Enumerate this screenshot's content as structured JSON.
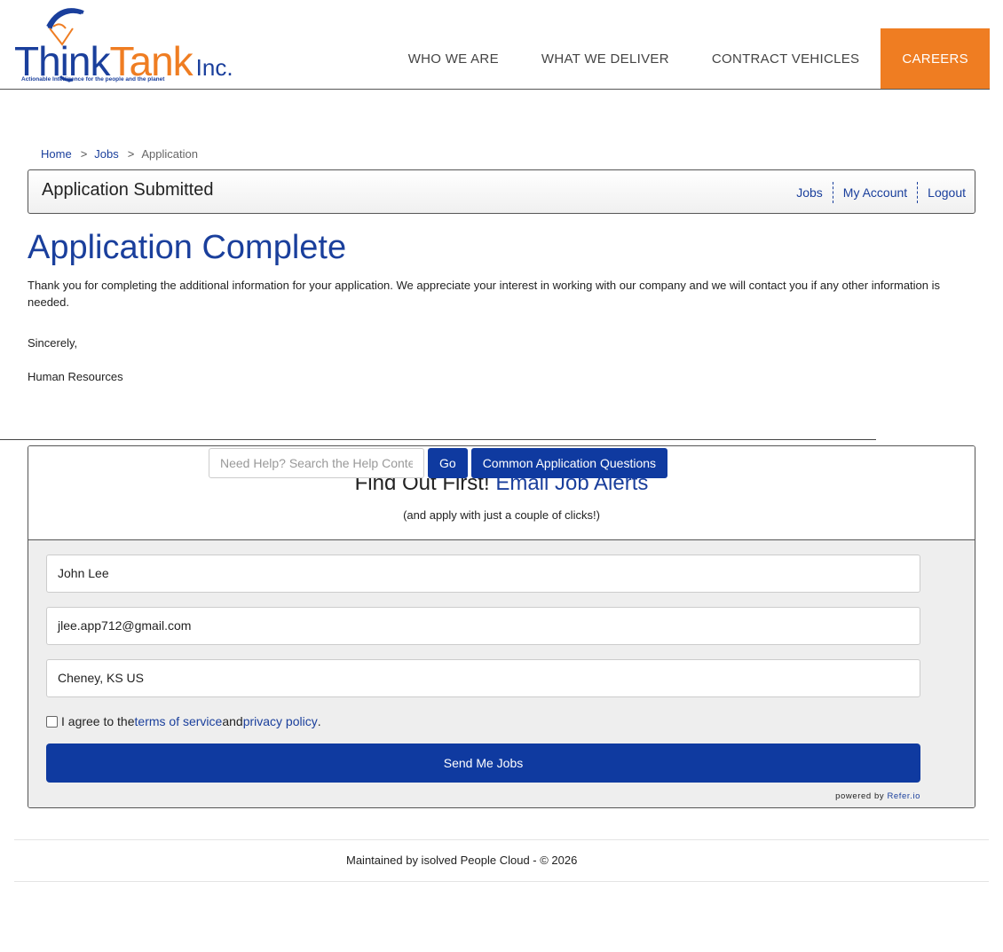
{
  "brand": {
    "name_part1": "Think",
    "name_part2": "Tank",
    "suffix": "Inc.",
    "tagline": "Actionable       Intelligence for the people and the planet",
    "colors": {
      "blue": "#1a3f9c",
      "orange": "#ef7d22"
    }
  },
  "nav": {
    "items": [
      {
        "label": "WHO WE ARE"
      },
      {
        "label": "WHAT WE DELIVER"
      },
      {
        "label": "CONTRACT VEHICLES"
      },
      {
        "label": "CAREERS",
        "active": true
      }
    ]
  },
  "breadcrumb": {
    "home": "Home",
    "jobs": "Jobs",
    "current": "Application",
    "separator": ">"
  },
  "status_bar": {
    "title": "Application Submitted",
    "links": [
      "Jobs",
      "My Account",
      "Logout"
    ]
  },
  "main": {
    "heading": "Application Complete",
    "message": "Thank you for completing the additional information for your application. We appreciate your interest in working with our company and we will contact you if any other information is needed.",
    "sincerely": "Sincerely,",
    "signoff": "Human Resources"
  },
  "help": {
    "placeholder": "Need Help? Search the Help Content",
    "go_label": "Go",
    "questions_label": "Common Application Questions"
  },
  "alerts": {
    "title_plain": "Find Out First! ",
    "title_highlight": "Email Job Alerts",
    "subtitle": "(and apply with just a couple of clicks!)",
    "name_value": "John Lee",
    "email_value": "jlee.app712@gmail.com",
    "location_value": "Cheney, KS US",
    "agree_prefix": "I agree to the ",
    "terms_label": "terms of service",
    "agree_and": " and ",
    "privacy_label": "privacy policy",
    "agree_suffix": ".",
    "agree_checked": false,
    "send_label": "Send Me Jobs",
    "powered_prefix": "powered by ",
    "powered_brand": "Refer.io"
  },
  "footer": {
    "text": "Maintained by isolved People Cloud - © 2026"
  },
  "accent_colors": {
    "primary_blue": "#0f3aa0",
    "orange": "#ef7d22",
    "link_blue": "#1a3f9c"
  }
}
